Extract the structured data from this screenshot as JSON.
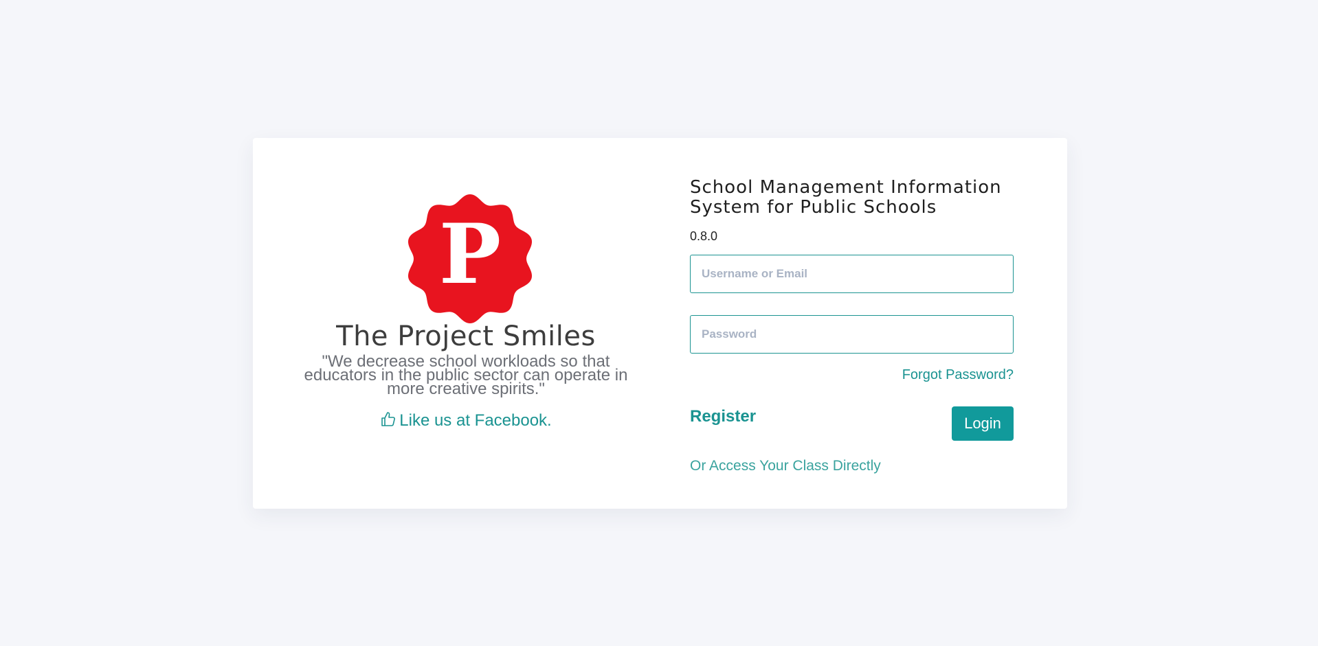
{
  "brand": {
    "logo_letter": "P",
    "logo_color": "#e8141f",
    "name": "The Project Smiles",
    "tagline": "\"We decrease school workloads so that educators in the public sector can operate in more creative spirits.\"",
    "facebook_label": "Like us at Facebook."
  },
  "login": {
    "system_title": "School Management Information System for Public Schools",
    "version": "0.8.0",
    "username_placeholder": "Username or Email",
    "password_placeholder": "Password",
    "forgot_label": "Forgot Password?",
    "register_label": "Register",
    "login_label": "Login",
    "class_access_label": "Or Access Your Class Directly"
  },
  "colors": {
    "accent": "#1a9391",
    "page_background": "#f5f6fa",
    "button_background": "#119a9b"
  },
  "icons": {
    "facebook": "thumbs-up-icon",
    "logo": "badge-p-logo"
  }
}
